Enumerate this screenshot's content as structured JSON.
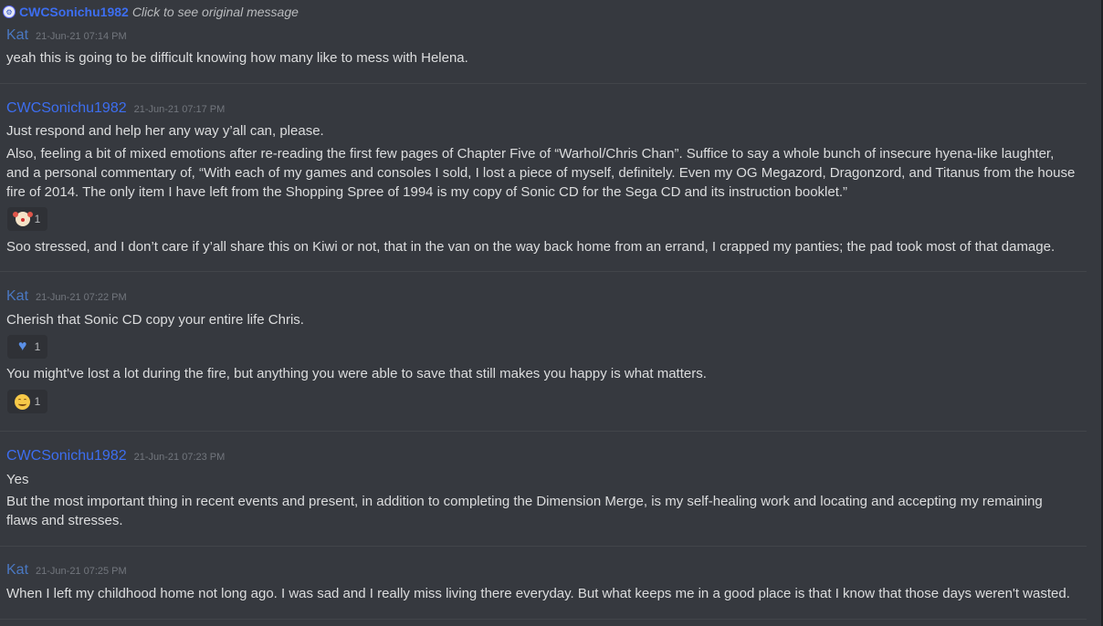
{
  "reply": {
    "author": "CWCSonichu1982",
    "text": "Click to see original message"
  },
  "messages": [
    {
      "author": "Kat",
      "timestamp": "21-Jun-21 07:14 PM",
      "lines": [
        "yeah this is going to be difficult knowing how many like to mess with Helena."
      ]
    },
    {
      "author": "CWCSonichu1982",
      "timestamp": "21-Jun-21 07:17 PM",
      "lines": [
        "Just respond and help her any way y’all can, please.",
        "Also, feeling a bit of mixed emotions after re-reading the first few pages of Chapter Five of “Warhol/Chris Chan”.  Suffice to say a whole bunch of insecure hyena-like laughter,",
        "and a personal commentary of, “With each of my games and consoles I sold, I lost a piece of myself, definitely.  Even my OG Megazord, Dragonzord, and Titanus from the house",
        "fire of 2014.  The only item I have left from the Shopping Spree of 1994 is my copy of Sonic CD for the Sega CD and its instruction booklet.”",
        "Soo stressed, and I don’t care if y’all share this on Kiwi or not, that in the van on the way back home from an errand, I crapped my panties; the pad took most of that damage."
      ],
      "reaction": {
        "emoji": "clown-emoji",
        "count": "1"
      }
    },
    {
      "author": "Kat",
      "timestamp": "21-Jun-21 07:22 PM",
      "lines": [
        "Cherish that Sonic CD copy your entire life Chris.",
        "You might've lost a lot during the fire, but anything you were able to save that still makes you happy is what matters."
      ],
      "reactions": [
        {
          "emoji": "blue-heart-emoji",
          "count": "1"
        },
        {
          "emoji": "smiling-face-emoji",
          "count": "1"
        }
      ]
    },
    {
      "author": "CWCSonichu1982",
      "timestamp": "21-Jun-21 07:23 PM",
      "lines": [
        "Yes",
        "But the most important thing in recent events and present, in addition to completing the Dimension Merge, is my self-healing work and locating and accepting my remaining",
        "flaws and stresses."
      ]
    },
    {
      "author": "Kat",
      "timestamp": "21-Jun-21 07:25 PM",
      "lines": [
        "When I left my childhood home not long ago. I was sad and I really miss living there everyday. But what keeps me in a good place is that I know that those days weren't wasted."
      ]
    }
  ],
  "colors": {
    "background": "#36393f",
    "username_blue": "#3d6ef0",
    "kat_blue": "#4a78c2",
    "text": "#dcddde",
    "timestamp": "#72767d"
  }
}
